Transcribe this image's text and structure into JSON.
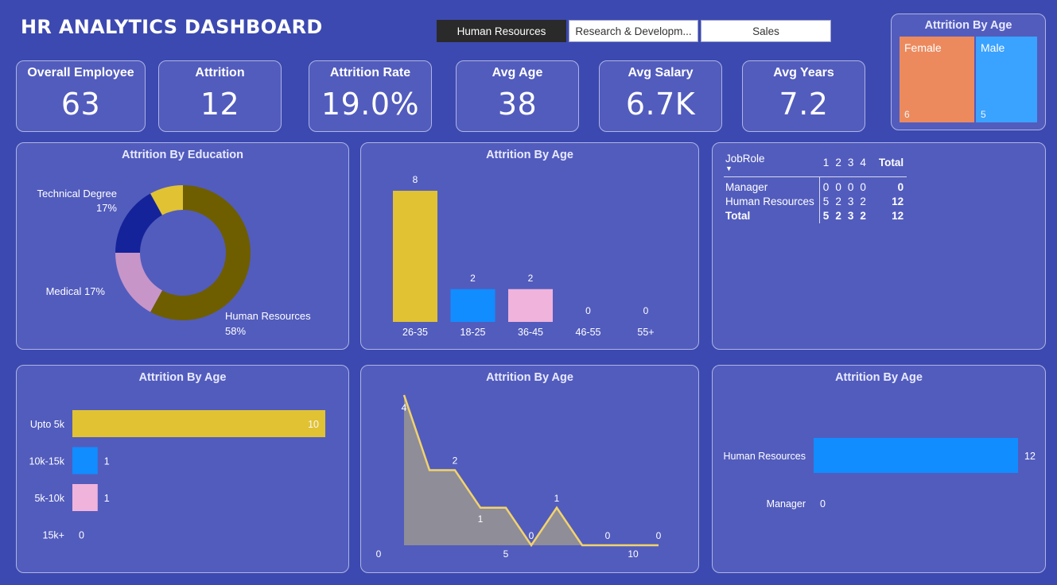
{
  "header": {
    "title": "HR ANALYTICS DASHBOARD"
  },
  "slicer": {
    "options": [
      "Human Resources",
      "Research & Developm...",
      "Sales"
    ],
    "selected": "Human Resources"
  },
  "kpis": [
    {
      "label": "Overall Employee",
      "value": "63"
    },
    {
      "label": "Attrition",
      "value": "12"
    },
    {
      "label": "Attrition Rate",
      "value": "19.0%"
    },
    {
      "label": "Avg Age",
      "value": "38"
    },
    {
      "label": "Avg Salary",
      "value": "6.7K"
    },
    {
      "label": "Avg Years",
      "value": "7.2"
    }
  ],
  "gender_treemap": {
    "title": "Attrition By Age",
    "items": [
      {
        "label": "Female",
        "value": "6",
        "color": "#ec8a5e"
      },
      {
        "label": "Male",
        "value": "5",
        "color": "#3aa2ff"
      }
    ]
  },
  "matrix": {
    "header": [
      "JobRole",
      "1",
      "2",
      "3",
      "4",
      "Total"
    ],
    "rows": [
      {
        "label": "Manager",
        "values": [
          "0",
          "0",
          "0",
          "0"
        ],
        "total": "0"
      },
      {
        "label": "Human Resources",
        "values": [
          "5",
          "2",
          "3",
          "2"
        ],
        "total": "12"
      }
    ],
    "total_row": {
      "label": "Total",
      "values": [
        "5",
        "2",
        "3",
        "2"
      ],
      "total": "12"
    }
  },
  "chart_data": [
    {
      "id": "education",
      "type": "pie",
      "title": "Attrition By Education",
      "slices": [
        {
          "label": "Human Resources",
          "value": 58,
          "display": "58%",
          "color": "#6e5e00"
        },
        {
          "label": "Medical",
          "value": 17,
          "display": "17%",
          "color": "#c795c8"
        },
        {
          "label": "Technical Degree",
          "value": 17,
          "display": "17%",
          "color": "#15239a"
        },
        {
          "label": "",
          "value": 8,
          "display": "",
          "color": "#e1c233"
        }
      ]
    },
    {
      "id": "age_bar",
      "type": "bar",
      "title": "Attrition By Age",
      "categories": [
        "26-35",
        "18-25",
        "36-45",
        "46-55",
        "55+"
      ],
      "values": [
        8,
        2,
        2,
        0,
        0
      ],
      "colors": [
        "#e1c233",
        "#118dff",
        "#f0b3dc",
        "#525cbd",
        "#525cbd"
      ],
      "ylim": [
        0,
        8
      ]
    },
    {
      "id": "salary_hbar",
      "type": "bar",
      "title": "Attrition By Age",
      "categories": [
        "Upto 5k",
        "10k-15k",
        "5k-10k",
        "15k+"
      ],
      "values": [
        10,
        1,
        1,
        0
      ],
      "colors": [
        "#e1c233",
        "#118dff",
        "#f0b3dc",
        "#525cbd"
      ],
      "xlim": [
        0,
        10
      ]
    },
    {
      "id": "years_area",
      "type": "area",
      "title": "Attrition By Age",
      "x": [
        1,
        2,
        3,
        4,
        5,
        6,
        7,
        8,
        9,
        10,
        11
      ],
      "y": [
        4,
        2,
        2,
        1,
        1,
        0,
        1,
        0,
        0,
        0,
        0
      ],
      "point_labels": [
        {
          "x": 1,
          "text": "4"
        },
        {
          "x": 3,
          "text": "2"
        },
        {
          "x": 5,
          "text": "1"
        },
        {
          "x": 6,
          "text": "0"
        },
        {
          "x": 7,
          "text": "1"
        },
        {
          "x": 9,
          "text": "0"
        },
        {
          "x": 11,
          "text": "0"
        }
      ],
      "xticks": [
        "0",
        "5",
        "10"
      ],
      "xlim": [
        0,
        11
      ],
      "ylim": [
        0,
        4
      ],
      "line_color": "#f2d36b",
      "fill_color": "#8f8d98"
    },
    {
      "id": "jobrole_hbar",
      "type": "bar",
      "title": "Attrition By Age",
      "categories": [
        "Human Resources",
        "Manager"
      ],
      "values": [
        12,
        0
      ],
      "colors": [
        "#118dff",
        "#118dff"
      ],
      "xlim": [
        0,
        12
      ]
    }
  ]
}
